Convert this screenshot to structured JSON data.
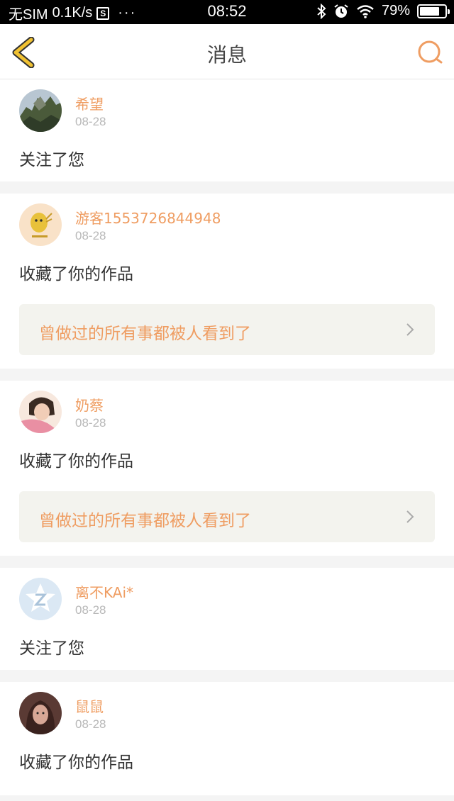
{
  "status_bar": {
    "carrier": "无SIM",
    "speed": "0.1K/s",
    "box_icon_label": "S",
    "dots": "···",
    "time": "08:52",
    "battery": "79%",
    "battery_level": 0.79
  },
  "nav": {
    "title": "消息",
    "back_icon": "chevron-left-icon",
    "search_icon": "search-icon"
  },
  "colors": {
    "accent": "#ef9d62",
    "back_yellow": "#f1c232",
    "card_link_bg": "#f3f3ee"
  },
  "messages": [
    {
      "user": "希望",
      "date": "08-28",
      "action": "关注了您"
    },
    {
      "user": "游客1553726844948",
      "date": "08-28",
      "action": "收藏了你的作品",
      "work": "曾做过的所有事都被人看到了"
    },
    {
      "user": "奶蔡",
      "date": "08-28",
      "action": "收藏了你的作品",
      "work": "曾做过的所有事都被人看到了"
    },
    {
      "user": "离不KAi*",
      "date": "08-28",
      "action": "关注了您"
    },
    {
      "user": "鼠鼠",
      "date": "08-28",
      "action": "收藏了你的作品"
    }
  ]
}
